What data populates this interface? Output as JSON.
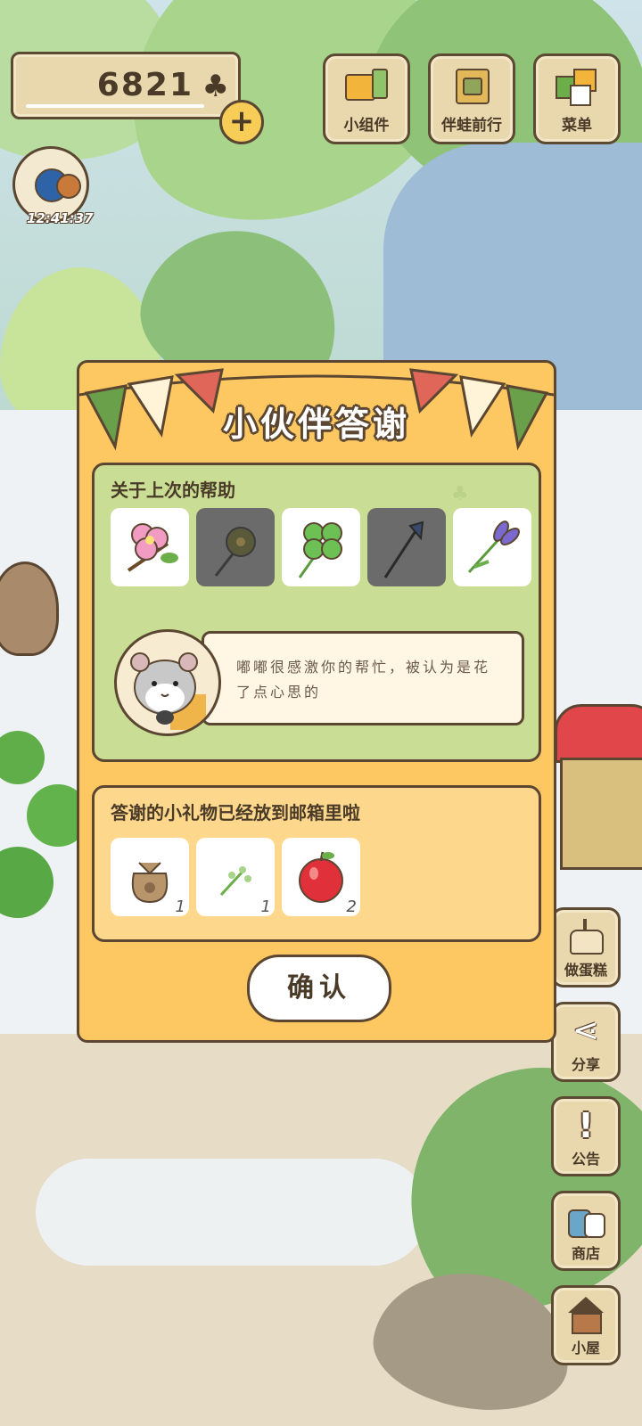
{
  "currency": {
    "amount": "6821",
    "icon": "clover-icon",
    "add_icon": "plus-icon"
  },
  "timer": {
    "value": "12:41:37"
  },
  "top_buttons": [
    {
      "label": "小组件",
      "icon": "widget-icon"
    },
    {
      "label": "伴蛙前行",
      "icon": "book-icon"
    },
    {
      "label": "菜单",
      "icon": "menu-icon"
    }
  ],
  "side_buttons": [
    {
      "label": "做蛋糕",
      "icon": "cake-icon"
    },
    {
      "label": "分享",
      "icon": "share-icon"
    },
    {
      "label": "公告",
      "icon": "exclamation-icon"
    },
    {
      "label": "商店",
      "icon": "shop-icon"
    },
    {
      "label": "小屋",
      "icon": "house-icon"
    }
  ],
  "dialog": {
    "title": "小伙伴答谢",
    "help_section": {
      "title": "关于上次的帮助",
      "items": [
        {
          "icon": "pink-flower-icon",
          "obtained": true
        },
        {
          "icon": "dark-flower-icon",
          "obtained": false
        },
        {
          "icon": "four-leaf-clover-icon",
          "obtained": true
        },
        {
          "icon": "blue-bellflower-icon",
          "obtained": false
        },
        {
          "icon": "purple-iris-icon",
          "obtained": true
        }
      ],
      "message": "嘟嘟很感激你的帮忙，被认为是花了点心思的"
    },
    "gift_section": {
      "title": "答谢的小礼物已经放到邮箱里啦",
      "items": [
        {
          "icon": "seed-bag-icon",
          "count": "1"
        },
        {
          "icon": "sprout-icon",
          "count": "1"
        },
        {
          "icon": "apple-icon",
          "count": "2"
        }
      ]
    },
    "confirm_label": "确认"
  },
  "colors": {
    "dialog_bg": "#fdc762",
    "help_panel": "#c9dd95",
    "gift_panel": "#fdd88c",
    "outline": "#5b4632"
  }
}
